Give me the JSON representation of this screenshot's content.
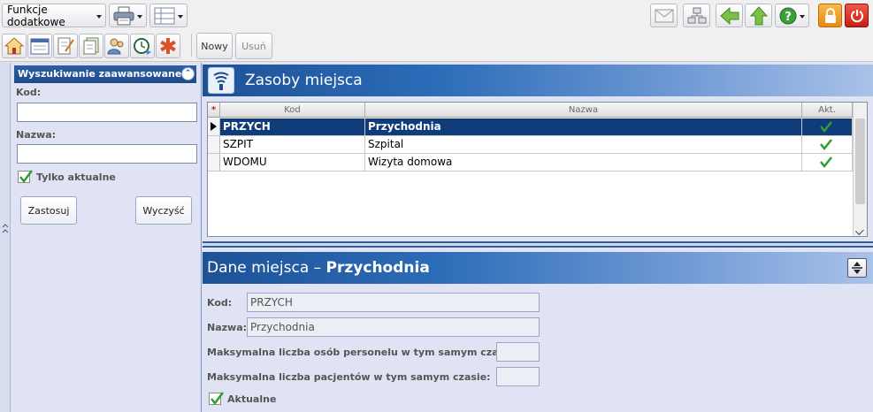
{
  "toolbar": {
    "functions_label": "Funkcje dodatkowe",
    "new_label": "Nowy",
    "delete_label": "Usuń"
  },
  "search_panel": {
    "title": "Wyszukiwanie zaawansowane",
    "code_label": "Kod:",
    "code_value": "",
    "name_label": "Nazwa:",
    "name_value": "",
    "only_current_label": "Tylko aktualne",
    "only_current_checked": true,
    "apply_label": "Zastosuj",
    "clear_label": "Wyczyść"
  },
  "list_section": {
    "title": "Zasoby miejsca",
    "columns": [
      "Kod",
      "Nazwa",
      "Akt."
    ],
    "rows": [
      {
        "code": "PRZYCH",
        "name": "Przychodnia",
        "active": true,
        "selected": true
      },
      {
        "code": "SZPIT",
        "name": "Szpital",
        "active": true,
        "selected": false
      },
      {
        "code": "WDOMU",
        "name": "Wizyta domowa",
        "active": true,
        "selected": false
      }
    ]
  },
  "details": {
    "title_prefix": "Dane miejsca – ",
    "title_name": "Przychodnia",
    "code_label": "Kod:",
    "code_value": "PRZYCH",
    "name_label": "Nazwa:",
    "name_value": "Przychodnia",
    "max_staff_label": "Maksymalna liczba osób personelu w tym samym czasie:",
    "max_staff_value": "",
    "max_patients_label": "Maksymalna liczba pacjentów w tym samym czasie:",
    "max_patients_value": "",
    "active_label": "Aktualne",
    "active_checked": true
  },
  "colors": {
    "header_blue": "#1e4a8a",
    "selected_row": "#113c7a",
    "check_green": "#2e9e2e",
    "lock_orange": "#f29a1e",
    "power_red": "#d92b1f"
  }
}
